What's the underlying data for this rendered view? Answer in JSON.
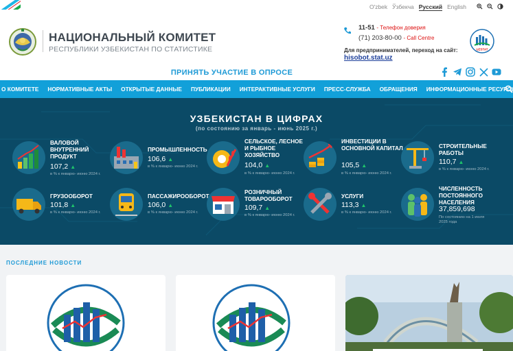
{
  "languages": [
    {
      "label": "O'zbek",
      "active": false
    },
    {
      "label": "Ўзбекча",
      "active": false
    },
    {
      "label": "Русский",
      "active": true
    },
    {
      "label": "English",
      "active": false
    }
  ],
  "header": {
    "title": "НАЦИОНАЛЬНЫЙ КОМИТЕТ",
    "subtitle": "РЕСПУБЛИКИ УЗБЕКИСТАН ПО СТАТИСТИКЕ",
    "hotline_number": "11-51",
    "hotline_label": "- Телефон доверия",
    "call_centre_number": "(71) 203-80-00",
    "call_centre_label": "- Call Centre",
    "business_text": "Для предпринимателей, переход на сайт:",
    "business_link": "hisobot.stat.uz",
    "uzstat_logo_text": "UZSTAT"
  },
  "survey_link": "ПРИНЯТЬ УЧАСТИЕ В ОПРОСЕ",
  "nav": [
    "О КОМИТЕТЕ",
    "НОРМАТИВНЫЕ АКТЫ",
    "ОТКРЫТЫЕ ДАННЫЕ",
    "ПУБЛИКАЦИИ",
    "ИНТЕРАКТИВНЫЕ УСЛУГИ",
    "ПРЕСС-СЛУЖБА",
    "ОБРАЩЕНИЯ",
    "ИНФОРМАЦИОННЫЕ РЕСУРСЫ"
  ],
  "stats": {
    "title": "УЗБЕКИСТАН В ЦИФРАХ",
    "subtitle": "(по состоянию за январь - июнь 2025 г.)",
    "items": [
      {
        "label": "Валовой внутренний продукт",
        "value": "107,2",
        "note": "в % к январю- июню 2024 г.",
        "icon": "gdp-chart-icon"
      },
      {
        "label": "Промышленность",
        "value": "106,6",
        "note": "в % к январю- июню 2024 г.",
        "icon": "factory-icon"
      },
      {
        "label": "Сельское, лесное и рыбное хозяйство",
        "value": "104,0",
        "note": "в % к январю- июню 2024 г.",
        "icon": "wheat-gear-icon"
      },
      {
        "label": "Инвестиции в основной капитал",
        "value": "105,5",
        "note": "в % к январю- июню 2024 г.",
        "icon": "coins-chart-icon"
      },
      {
        "label": "Строительные работы",
        "value": "110,7",
        "note": "в % к январю- июню 2024 г.",
        "icon": "crane-icon"
      },
      {
        "label": "Грузооборот",
        "value": "101,8",
        "note": "в % к январю- июню 2024 г.",
        "icon": "truck-icon"
      },
      {
        "label": "Пассажирооборот",
        "value": "106,0",
        "note": "в % к январю- июню 2024 г.",
        "icon": "train-icon"
      },
      {
        "label": "Розничный товарооборот",
        "value": "109,7",
        "note": "в % к январю- июню 2024 г.",
        "icon": "shop-icon"
      },
      {
        "label": "Услуги",
        "value": "113,3",
        "note": "в % к январю- июню 2024 г.",
        "icon": "tools-icon"
      },
      {
        "label": "Численность постоянного населения",
        "value": "37,859,698",
        "note": "По состоянию на 1 июля 2025 года",
        "icon": "people-icon"
      }
    ]
  },
  "news": {
    "heading": "ПОСЛЕДНИЕ НОВОСТИ"
  },
  "colors": {
    "accent": "#12a0d9",
    "stats_bg": "#0b4a66",
    "trend_up": "#1ec46b",
    "hotline_red": "#dd1111"
  }
}
